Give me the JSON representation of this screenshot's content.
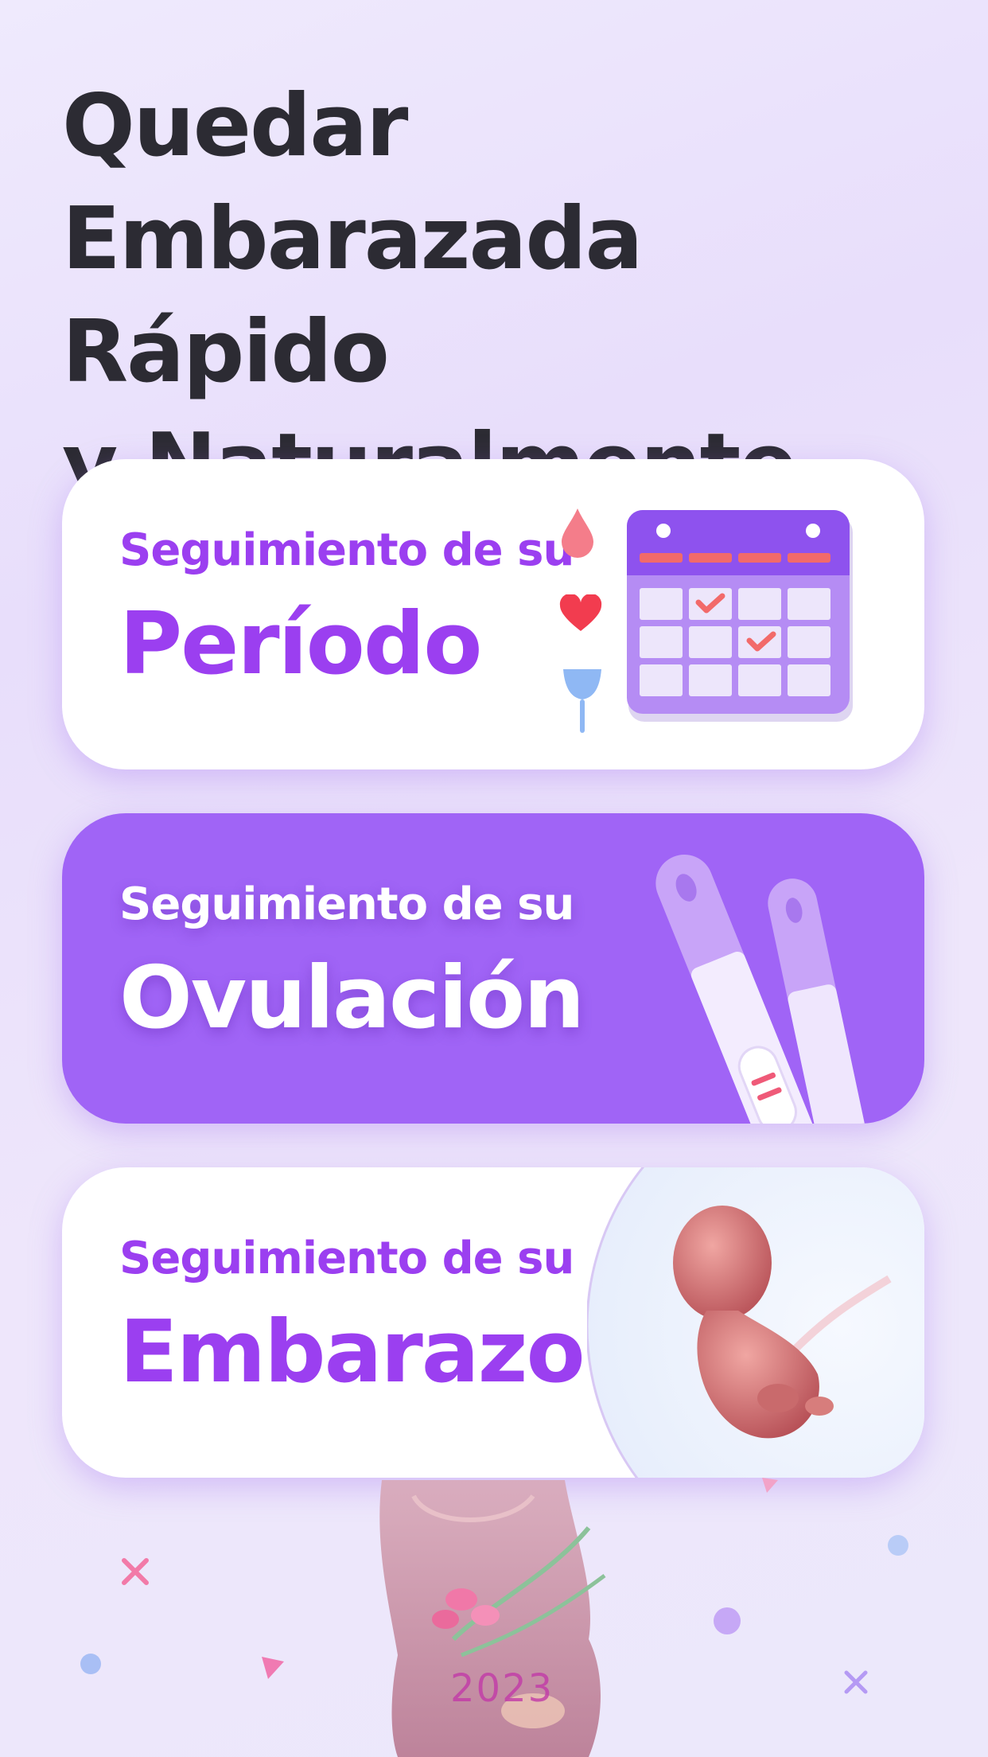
{
  "headline": {
    "line1": "Quedar",
    "line2": "Embarazada Rápido",
    "line3": "y Naturalmente"
  },
  "cards": [
    {
      "subtitle": "Seguimiento de su",
      "title": "Período",
      "icons": [
        "blood-drop-icon",
        "heart-icon",
        "menstrual-cup-icon",
        "calendar-icon"
      ]
    },
    {
      "subtitle": "Seguimiento de su",
      "title": "Ovulación",
      "icons": [
        "ovulation-test-icon"
      ]
    },
    {
      "subtitle": "Seguimiento de su",
      "title": "Embarazo",
      "icons": [
        "fetus-illustration"
      ]
    }
  ],
  "footer": {
    "year_text": "2023"
  },
  "colors": {
    "accent": "#9b3ff0",
    "purple_card": "#a064f6",
    "headline": "#2c2b33"
  }
}
